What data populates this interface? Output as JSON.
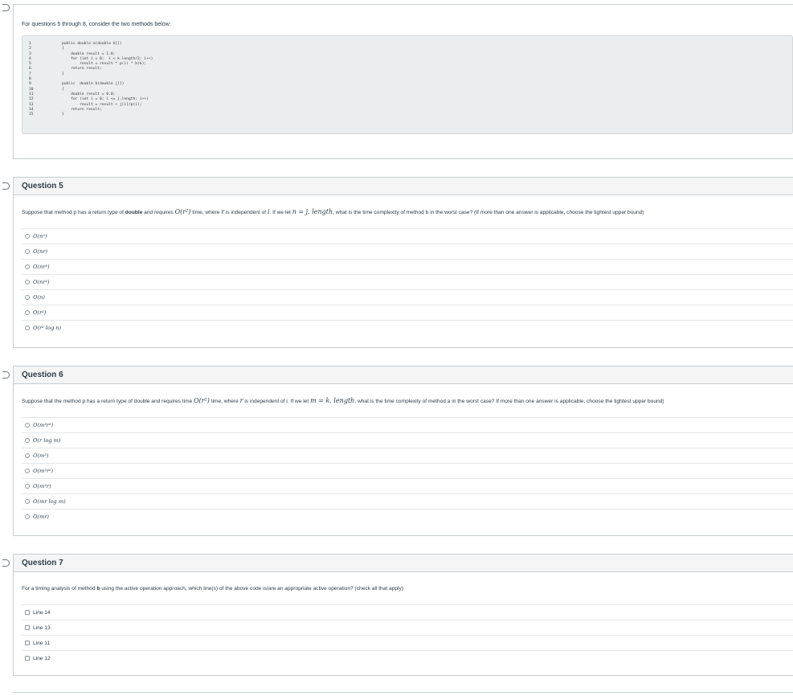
{
  "intro_card": {
    "text": "For questions 5 through 8, consider the two methods below:",
    "line_numbers": [
      "1",
      "2",
      "3",
      "4",
      "5",
      "6",
      "7",
      "8",
      "9",
      "10",
      "11",
      "12",
      "13",
      "14",
      "15"
    ],
    "code_lines": [
      "public double a(double k[])",
      "{",
      "    double result = 1.0;",
      "    for (int i = 0;  i < k.length/2; i++)",
      "        result = result * p(i) * b(k);",
      "    return result;",
      "}",
      "",
      "public  double b(double j[])",
      "{",
      "    double result = 0.0;",
      "    for (int i = 0; i <= j.length; i++)",
      "        result = result + j[i]/p(i);",
      "    return result;",
      "}"
    ]
  },
  "q5": {
    "title": "Question 5",
    "t1": "Suppose that method p has a return type of ",
    "t_bold": "double",
    "t2": " and requires ",
    "m1": "O(r²)",
    "t3": " time, where ",
    "m2": "r",
    "t4": " is independent of ",
    "m3": "i",
    "t5": ".  If we let ",
    "m4": "n = j. length",
    "t6": ", what is the time complexity of method b in the worst case? (If more than one answer is applicable, choose the tightest upper bound)",
    "answers": [
      "O(n²)",
      "O(nr)",
      "O(nr³)",
      "O(nr²)",
      "O(n)",
      "O(r²)",
      "O(r² log n)"
    ]
  },
  "q6": {
    "title": "Question 6",
    "t1": "Suppose that the method p has a return type of double and requires time ",
    "m1": "O(r²)",
    "t2": " time, where ",
    "m2": "r",
    "t3": " is independent of i. If we let ",
    "m3": "m = k. length",
    "t4": ", what is the time complexity of method a in the worst case? If more than one answer is applicable, choose the tightest upper bound)",
    "answers": [
      "O(m³r²)",
      "O(r log m)",
      "O(m³)",
      "O(m²r²)",
      "O(m²r)",
      "O(mr log m)",
      "O(mr)"
    ]
  },
  "q7": {
    "title": "Question 7",
    "t1": "For a timing analysis of method ",
    "t_bold": "b",
    "t2": " using the active operation approach, which line(s) of the above code is/are an appropriate active operation? (check all that apply)",
    "answers": [
      "Line 14",
      "Line 13",
      "Line 11",
      "Line 12"
    ]
  }
}
